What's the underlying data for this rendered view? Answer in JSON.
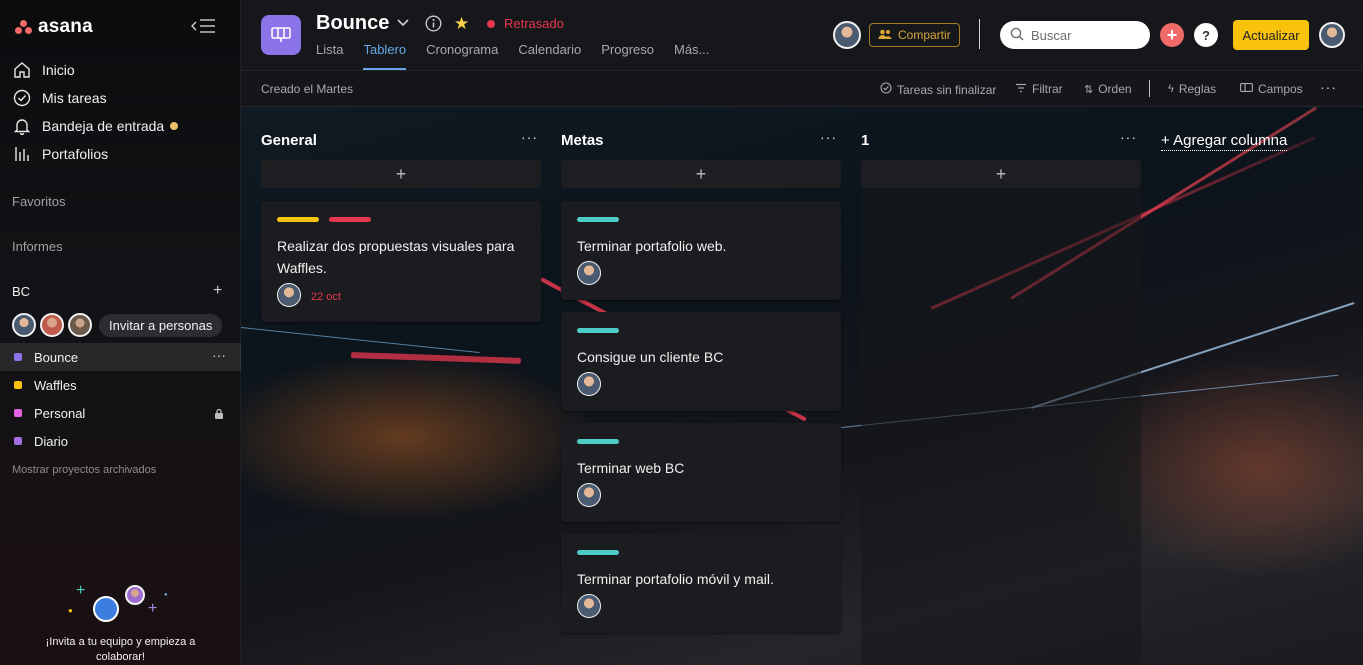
{
  "brand": {
    "name": "asana"
  },
  "sidebar": {
    "nav": [
      {
        "label": "Inicio",
        "icon": "home-icon"
      },
      {
        "label": "Mis tareas",
        "icon": "check-circle-icon"
      },
      {
        "label": "Bandeja de entrada",
        "icon": "bell-icon"
      },
      {
        "label": "Portafolios",
        "icon": "bar-chart-icon"
      }
    ],
    "favorites_label": "Favoritos",
    "reports_label": "Informes",
    "team_label": "BC",
    "invite_label": "Invitar a personas",
    "projects": [
      {
        "label": "Bounce",
        "color": "#8b73e8"
      },
      {
        "label": "Waffles",
        "color": "#f8c20d"
      },
      {
        "label": "Personal",
        "color": "#e362e3"
      },
      {
        "label": "Diario",
        "color": "#a36fe0"
      }
    ],
    "archived_label": "Mostrar proyectos archivados",
    "promo_text": "¡Invita a tu equipo y empieza a colaborar!"
  },
  "header": {
    "project_title": "Bounce",
    "status": "Retrasado",
    "tabs": [
      "Lista",
      "Tablero",
      "Cronograma",
      "Calendario",
      "Progreso",
      "Más..."
    ],
    "active_tab": "Tablero",
    "share_label": "Compartir",
    "search_placeholder": "Buscar",
    "help_label": "?",
    "upgrade_label": "Actualizar"
  },
  "toolbar": {
    "created": "Creado el Martes",
    "incomplete": "Tareas sin finalizar",
    "filter": "Filtrar",
    "sort": "Orden",
    "rules": "Reglas",
    "fields": "Campos"
  },
  "board": {
    "add_column_label": "+ Agregar columna",
    "columns": [
      {
        "title": "General",
        "cards": [
          {
            "title": "Realizar dos propuestas visuales para Waffles.",
            "tags": [
              "#f8c20d",
              "#e8384f"
            ],
            "due": "22 oct"
          }
        ]
      },
      {
        "title": "Metas",
        "cards": [
          {
            "title": "Terminar portafolio web.",
            "tags": [
              "#4ecbc4"
            ]
          },
          {
            "title": "Consigue un cliente BC",
            "tags": [
              "#4ecbc4"
            ]
          },
          {
            "title": "Terminar web BC",
            "tags": [
              "#4ecbc4"
            ]
          },
          {
            "title": "Terminar portafolio móvil y mail.",
            "tags": [
              "#4ecbc4"
            ]
          }
        ]
      },
      {
        "title": "1",
        "cards": []
      }
    ]
  },
  "colors": {
    "accent_tab": "#68a8e8",
    "status_red": "#e8384f",
    "upgrade_yellow": "#f8c20d",
    "add_button": "#f06a6a",
    "project_icon": "#8b73e8"
  }
}
